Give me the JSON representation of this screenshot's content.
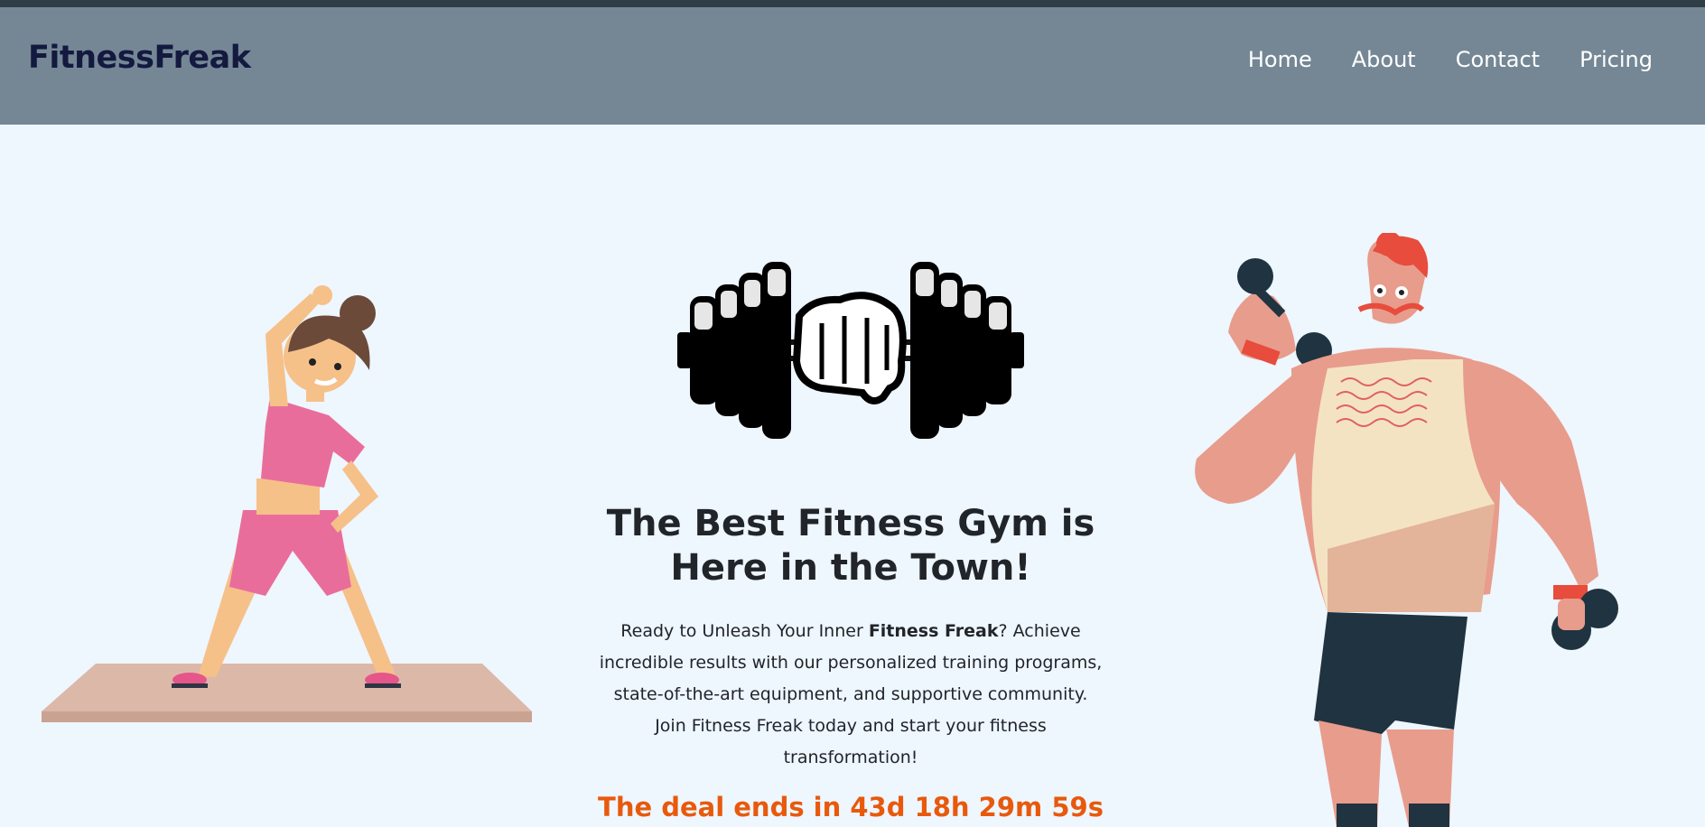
{
  "header": {
    "logo": "FitnessFreak",
    "nav": [
      {
        "label": "Home"
      },
      {
        "label": "About"
      },
      {
        "label": "Contact"
      },
      {
        "label": "Pricing"
      }
    ]
  },
  "hero": {
    "headline_line1": "The Best Fitness Gym is",
    "headline_line2": "Here in the Town!",
    "desc_before": "Ready to Unleash Your Inner ",
    "desc_bold": "Fitness Freak",
    "desc_after": "? Achieve incredible results with our personalized training programs, state-of-the-art equipment, and supportive community. Join Fitness Freak today and start your fitness transformation!",
    "deal_label": "The deal ends in 43d 18h 29m 59s"
  },
  "images": {
    "left": "woman-stretching-illustration",
    "center": "dumbbell-fist-icon",
    "right": "man-lifting-dumbbells-illustration"
  },
  "colors": {
    "navbar_bg": "#758795",
    "logo": "#14193f",
    "page_bg": "#eef6fe",
    "deal_text": "#e8590c"
  }
}
